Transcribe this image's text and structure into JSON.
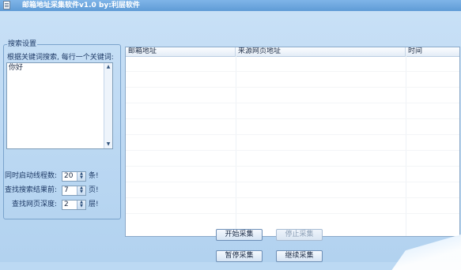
{
  "window": {
    "title": "邮箱地址采集软件v1.0  by:利层软件"
  },
  "search_settings": {
    "group_title": "搜索设置",
    "hint": "根据关键词搜索, 每行一个关键词:",
    "keywords_value": "你好"
  },
  "settings": [
    {
      "label": "同时启动线程数:",
      "value": "20",
      "unit": "条!"
    },
    {
      "label": "查找搜索结果前:",
      "value": "7",
      "unit": "页!"
    },
    {
      "label": "查找网页深度:",
      "value": "2",
      "unit": "层!"
    }
  ],
  "results_table": {
    "columns": [
      "邮箱地址",
      "来源网页地址",
      "时间"
    ]
  },
  "buttons": {
    "start": "开始采集",
    "stop": "停止采集",
    "pause": "暂停采集",
    "resume": "继续采集"
  },
  "colors": {
    "title_bar": "#6ea8e0",
    "window_background": "#bcd9f3",
    "list_background": "#ffffff"
  },
  "icons": {
    "app": "document-icon",
    "spin_up": "arrow-up-icon",
    "spin_down": "arrow-down-icon"
  }
}
